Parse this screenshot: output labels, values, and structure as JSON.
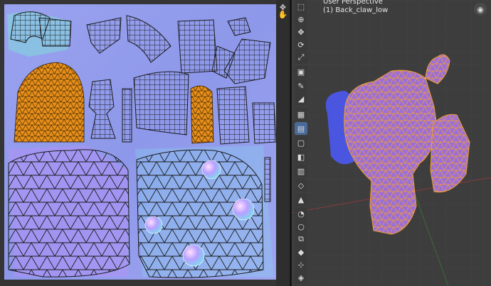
{
  "uv_editor": {
    "tools": [
      {
        "name": "move-icon",
        "glyph": "✥"
      },
      {
        "name": "hand-icon",
        "glyph": "✋"
      }
    ]
  },
  "viewport": {
    "view_name": "User Perspective",
    "object_label": "(1) Back_claw_low",
    "tools": [
      {
        "name": "select-box-tool",
        "glyph": "⬚"
      },
      {
        "name": "cursor-tool",
        "glyph": "⊕"
      },
      {
        "name": "move-tool",
        "glyph": "✥"
      },
      {
        "name": "rotate-tool",
        "glyph": "⟳"
      },
      {
        "name": "scale-tool",
        "glyph": "⤢"
      },
      {
        "name": "transform-tool",
        "glyph": "▣"
      },
      {
        "name": "annotate-tool",
        "glyph": "✎"
      },
      {
        "name": "measure-tool",
        "glyph": "◢"
      },
      {
        "name": "add-cube-tool",
        "glyph": "▦"
      },
      {
        "name": "extrude-tool",
        "glyph": "▤"
      },
      {
        "name": "inset-tool",
        "glyph": "▢"
      },
      {
        "name": "bevel-tool",
        "glyph": "◧"
      },
      {
        "name": "loop-cut-tool",
        "glyph": "▥"
      },
      {
        "name": "knife-tool",
        "glyph": "◇"
      },
      {
        "name": "poly-build-tool",
        "glyph": "▲"
      },
      {
        "name": "spin-tool",
        "glyph": "◔"
      },
      {
        "name": "smooth-tool",
        "glyph": "○"
      },
      {
        "name": "edge-slide-tool",
        "glyph": "⧉"
      },
      {
        "name": "shrink-tool",
        "glyph": "◆"
      },
      {
        "name": "shear-tool",
        "glyph": "⊹"
      },
      {
        "name": "rip-tool",
        "glyph": "◈"
      }
    ],
    "gizmo_glyph": "◉"
  }
}
